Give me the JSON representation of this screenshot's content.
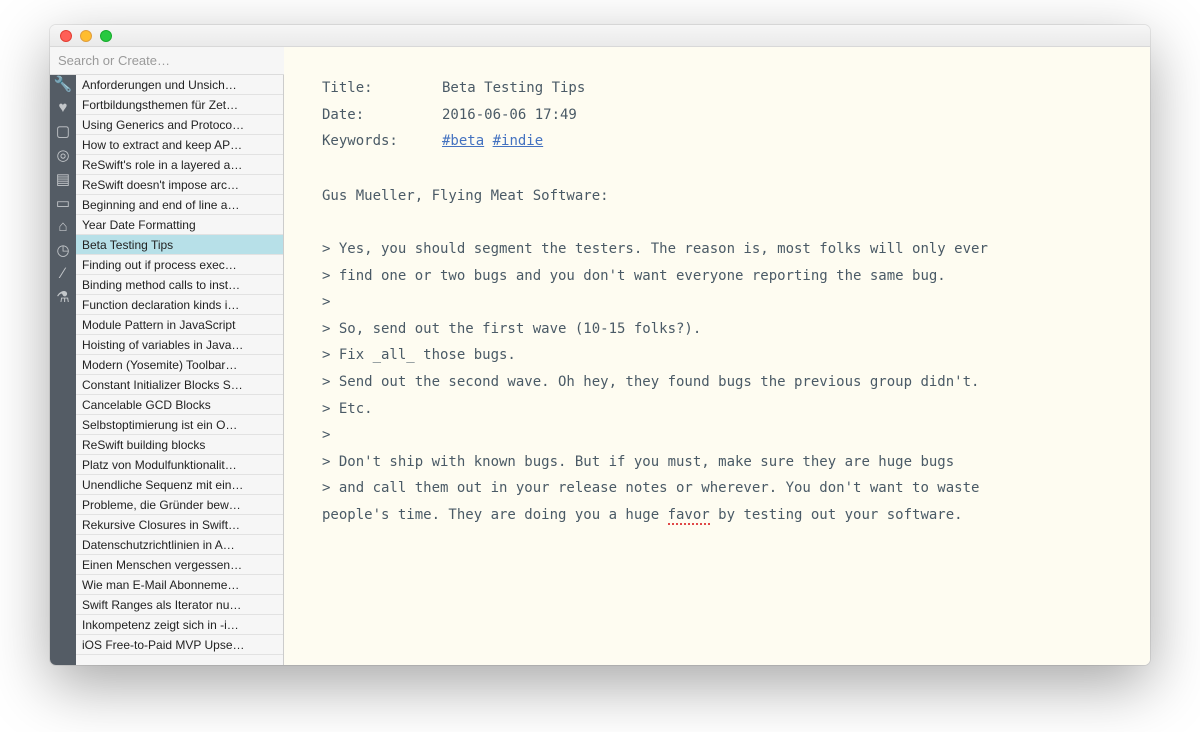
{
  "search": {
    "placeholder": "Search or Create…"
  },
  "selected_index": 8,
  "sidebar_icons": [
    {
      "name": "wrench-icon",
      "glyph": "🔧"
    },
    {
      "name": "heart-icon",
      "glyph": "♥"
    },
    {
      "name": "square-icon",
      "glyph": "▢"
    },
    {
      "name": "compass-icon",
      "glyph": "◎"
    },
    {
      "name": "board-icon",
      "glyph": "▤"
    },
    {
      "name": "page-icon",
      "glyph": "▭"
    },
    {
      "name": "home-icon",
      "glyph": "⌂"
    },
    {
      "name": "clock-icon",
      "glyph": "◷"
    },
    {
      "name": "pin-icon",
      "glyph": "∕"
    },
    {
      "name": "flask-icon",
      "glyph": "⚗"
    }
  ],
  "notes": [
    "Anforderungen und Unsich…",
    "Fortbildungsthemen für Zet…",
    "Using Generics and Protoco…",
    "How to extract and keep AP…",
    "ReSwift's role in a layered a…",
    "ReSwift doesn't impose arc…",
    "Beginning and end of line a…",
    "Year Date Formatting",
    "Beta Testing Tips",
    "Finding out if process exec…",
    "Binding method calls to inst…",
    "Function declaration kinds i…",
    "Module Pattern in JavaScript",
    "Hoisting of variables in Java…",
    "Modern (Yosemite) Toolbar…",
    "Constant Initializer Blocks S…",
    "Cancelable GCD Blocks",
    "Selbstoptimierung ist ein O…",
    "ReSwift building blocks",
    "Platz von Modulfunktionalit…",
    "Unendliche Sequenz mit ein…",
    "Probleme, die Gründer bew…",
    "Rekursive Closures in Swift…",
    "Datenschutzrichtlinien in A…",
    "Einen Menschen vergessen…",
    "Wie man E-Mail Abonneme…",
    "Swift Ranges als Iterator nu…",
    "Inkompetenz zeigt sich in -i…",
    "iOS Free-to-Paid MVP Upse…"
  ],
  "editor": {
    "meta": {
      "title_label": "Title:",
      "title_value": "Beta Testing Tips",
      "date_label": "Date:",
      "date_value": "2016-06-06 17:49",
      "keywords_label": "Keywords:",
      "tag1": "#beta",
      "tag2": "#indie"
    },
    "attribution": "Gus Mueller, Flying Meat Software:",
    "lines": [
      "> Yes, you should segment the testers. The reason is, most folks will only ever",
      "> find one or two bugs and you don't want everyone reporting the same bug.",
      ">",
      "> So, send out the first wave (10-15 folks?).",
      "> Fix _all_ those bugs.",
      "> Send out the second wave. Oh hey, they found bugs the previous group didn't.",
      "> Etc.",
      ">",
      "> Don't ship with known bugs. But if you must, make sure they are huge bugs",
      "> and call them out in your release notes or wherever. You don't want to waste"
    ],
    "last_line_pre": "people's time. They are doing you a huge ",
    "last_line_spell": "favor",
    "last_line_post": " by testing out your software."
  }
}
